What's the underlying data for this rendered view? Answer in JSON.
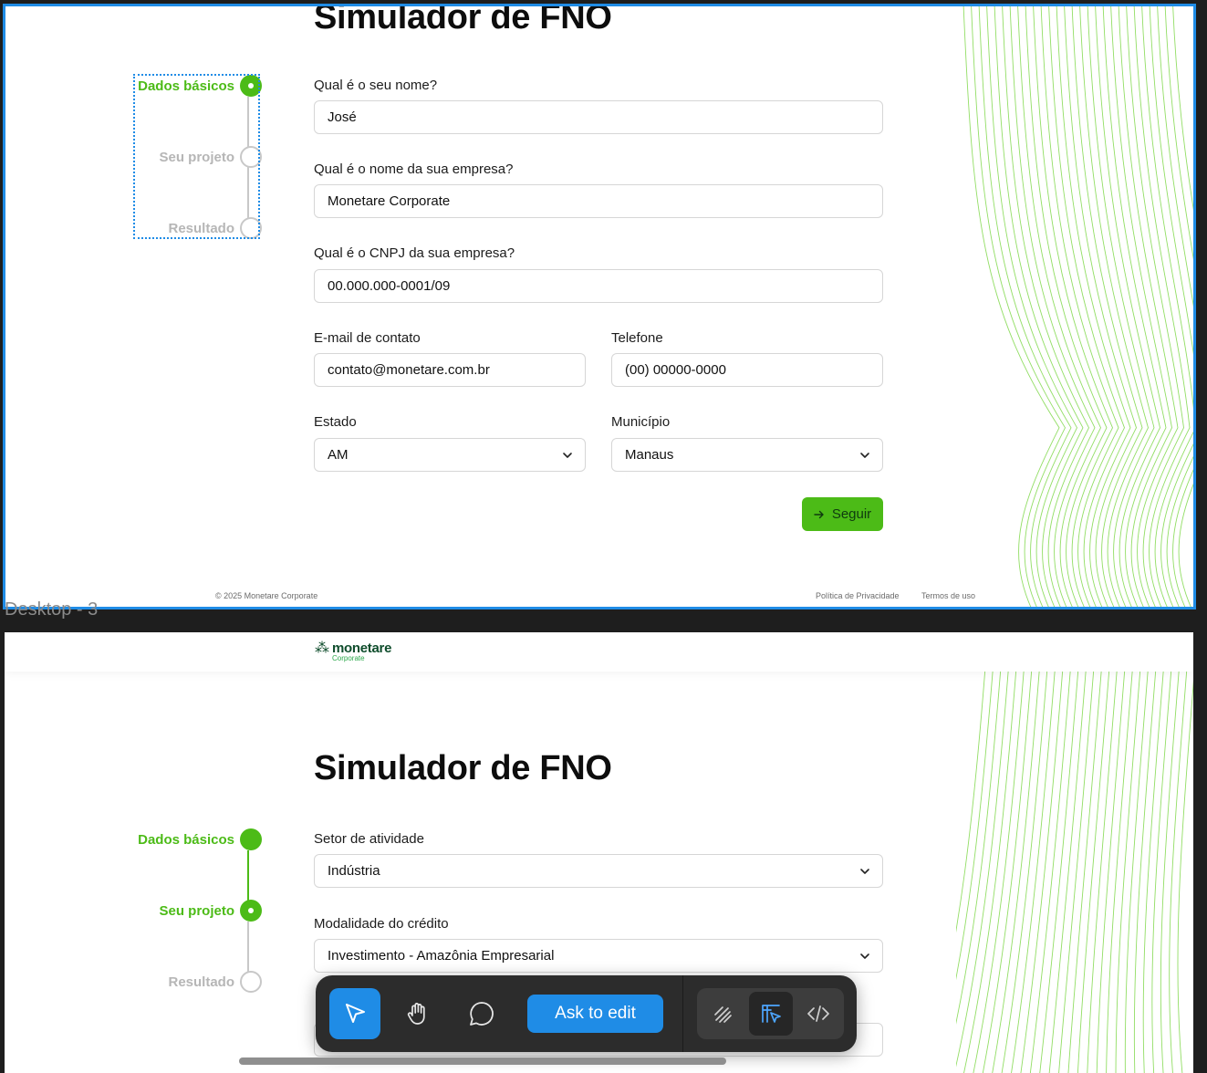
{
  "colors": {
    "accent": "#4cbb17",
    "selection": "#1f8ce6",
    "inactive": "#b6b6b6",
    "canvas": "#1e1e1e"
  },
  "frame1": {
    "title": "Simulador de FNO",
    "steps": [
      {
        "label": "Dados básicos",
        "state": "current"
      },
      {
        "label": "Seu projeto",
        "state": "pending"
      },
      {
        "label": "Resultado",
        "state": "pending"
      }
    ],
    "fields": {
      "nome": {
        "label": "Qual é o seu nome?",
        "value": "José"
      },
      "empresa": {
        "label": "Qual é o nome da sua empresa?",
        "value": "Monetare Corporate"
      },
      "cnpj": {
        "label": "Qual é o CNPJ da sua empresa?",
        "value": "00.000.000-0001/09"
      },
      "email": {
        "label": "E-mail de contato",
        "value": "contato@monetare.com.br"
      },
      "telefone": {
        "label": "Telefone",
        "value": "(00) 00000-0000"
      },
      "estado": {
        "label": "Estado",
        "value": "AM"
      },
      "municipio": {
        "label": "Município",
        "value": "Manaus"
      }
    },
    "next_button": {
      "label": "Seguir",
      "icon": "arrow-right-icon"
    },
    "footer": {
      "copyright": "© 2025 Monetare Corporate",
      "privacy": "Política de Privacidade",
      "terms": "Termos de uso"
    }
  },
  "frame_label": "Desktop - 3",
  "frame2": {
    "logo": {
      "name": "monetare",
      "sub": "Corporate"
    },
    "title": "Simulador de FNO",
    "steps": [
      {
        "label": "Dados básicos",
        "state": "done"
      },
      {
        "label": "Seu projeto",
        "state": "current"
      },
      {
        "label": "Resultado",
        "state": "pending"
      }
    ],
    "fields": {
      "setor": {
        "label": "Setor de atividade",
        "value": "Indústria"
      },
      "modalidade": {
        "label": "Modalidade do crédito",
        "value": "Investimento - Amazônia Empresarial"
      }
    }
  },
  "toolbar": {
    "tools": [
      "cursor-icon",
      "hand-icon",
      "comment-icon"
    ],
    "ask_label": "Ask to edit",
    "modes": [
      "draw-icon",
      "design-mode-icon",
      "code-icon"
    ]
  }
}
